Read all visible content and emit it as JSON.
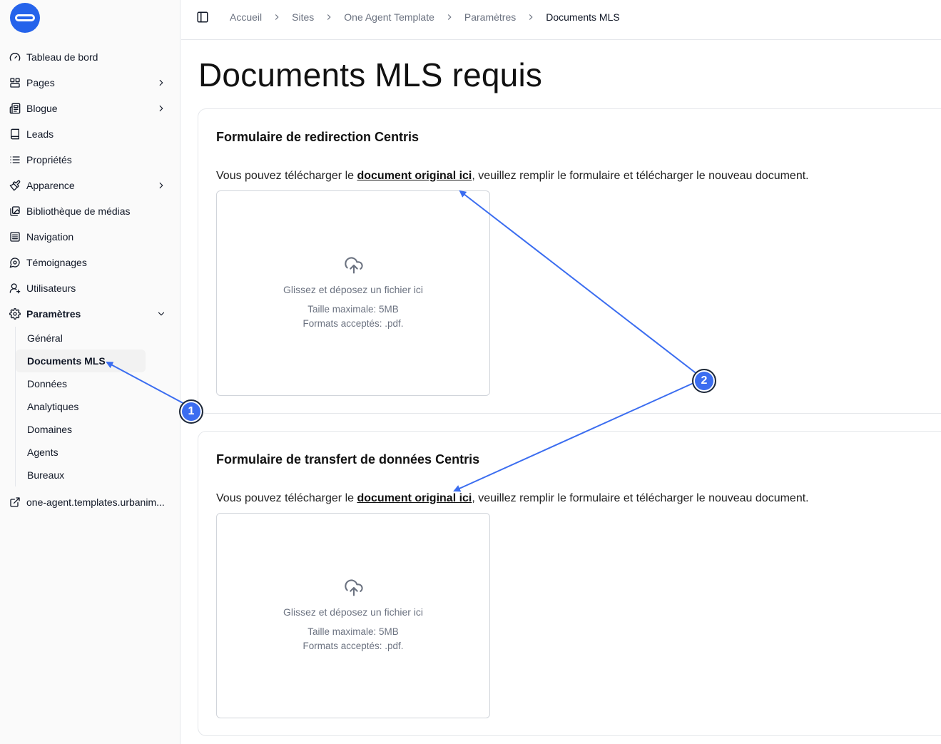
{
  "sidebar": {
    "items": [
      {
        "label": "Tableau de bord",
        "icon": "gauge-icon"
      },
      {
        "label": "Pages",
        "icon": "layout-icon"
      },
      {
        "label": "Blogue",
        "icon": "newspaper-icon"
      },
      {
        "label": "Leads",
        "icon": "book-icon"
      },
      {
        "label": "Propriétés",
        "icon": "list-icon"
      },
      {
        "label": "Apparence",
        "icon": "paintbrush-icon"
      },
      {
        "label": "Bibliothèque de médias",
        "icon": "images-icon"
      },
      {
        "label": "Navigation",
        "icon": "menu-square-icon"
      },
      {
        "label": "Témoignages",
        "icon": "message-circle-icon"
      },
      {
        "label": "Utilisateurs",
        "icon": "users-icon"
      },
      {
        "label": "Paramètres",
        "icon": "gear-icon"
      }
    ],
    "settings_sub": [
      "Général",
      "Documents MLS",
      "Données",
      "Analytiques",
      "Domaines",
      "Agents",
      "Bureaux"
    ],
    "external_link": "one-agent.templates.urbanim..."
  },
  "breadcrumb": [
    "Accueil",
    "Sites",
    "One Agent Template",
    "Paramètres",
    "Documents MLS"
  ],
  "page_title": "Documents MLS requis",
  "sections": [
    {
      "title": "Formulaire de redirection Centris",
      "desc_before": "Vous pouvez télécharger le ",
      "desc_link": "document original ici",
      "desc_after": ", veuillez remplir le formulaire et télécharger le nouveau document.",
      "drop_text": "Glissez et déposez un fichier ici",
      "max_size": "Taille maximale: 5MB",
      "formats": "Formats acceptés: .pdf."
    },
    {
      "title": "Formulaire de transfert de données Centris",
      "desc_before": "Vous pouvez télécharger le ",
      "desc_link": "document original ici",
      "desc_after": ", veuillez remplir le formulaire et télécharger le nouveau document.",
      "drop_text": "Glissez et déposez un fichier ici",
      "max_size": "Taille maximale: 5MB",
      "formats": "Formats acceptés: .pdf."
    }
  ],
  "annotations": {
    "badge1": "1",
    "badge2": "2",
    "color": "#3b6df0"
  }
}
